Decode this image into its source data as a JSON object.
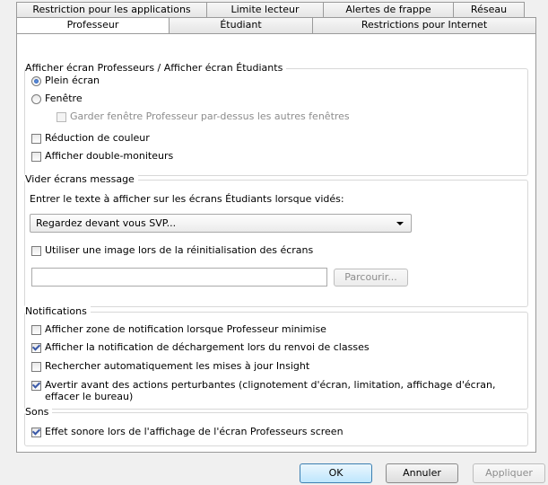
{
  "tabs": {
    "row1": [
      "Restriction pour les applications",
      "Limite lecteur",
      "Alertes de frappe",
      "Réseau"
    ],
    "row2": [
      "Professeur",
      "Étudiant",
      "Restrictions pour Internet"
    ]
  },
  "display": {
    "legend": "Afficher écran Professeurs  / Afficher écran Étudiants",
    "fullscreen": {
      "label": "Plein écran",
      "selected": true
    },
    "window": {
      "label": "Fenêtre",
      "selected": false
    },
    "keep_on_top": {
      "label": "Garder fenêtre Professeur par-dessus les autres fenêtres",
      "checked": false,
      "enabled": false
    },
    "color_reduction": {
      "label": "Réduction de couleur",
      "checked": false
    },
    "dual_monitor": {
      "label": "Afficher double-moniteurs",
      "checked": false
    }
  },
  "blank": {
    "legend": "Vider écrans message",
    "prompt": "Entrer le texte à afficher sur les écrans Étudiants lorsque vidés:",
    "message": "Regardez devant vous SVP...",
    "use_image": {
      "label": "Utiliser une image lors de la réinitialisation des écrans",
      "checked": false
    },
    "image_path": "",
    "browse_label": "Parcourir..."
  },
  "notifications": {
    "legend": "Notifications",
    "items": [
      {
        "label": "Afficher zone de notification lorsque Professeur minimise",
        "checked": false
      },
      {
        "label": "Afficher la notification de déchargement lors du renvoi de classes",
        "checked": true
      },
      {
        "label": "Rechercher automatiquement les mises à jour Insight",
        "checked": false
      },
      {
        "label": "Avertir avant des actions perturbantes (clignotement d'écran, limitation, affichage d'écran,",
        "label2": "effacer le bureau)",
        "checked": true
      }
    ]
  },
  "sounds": {
    "legend": "Sons",
    "effect": {
      "label": "Effet sonore lors de l'affichage de l'écran Professeurs screen",
      "checked": true
    }
  },
  "buttons": {
    "ok": "OK",
    "cancel": "Annuler",
    "apply": "Appliquer"
  }
}
